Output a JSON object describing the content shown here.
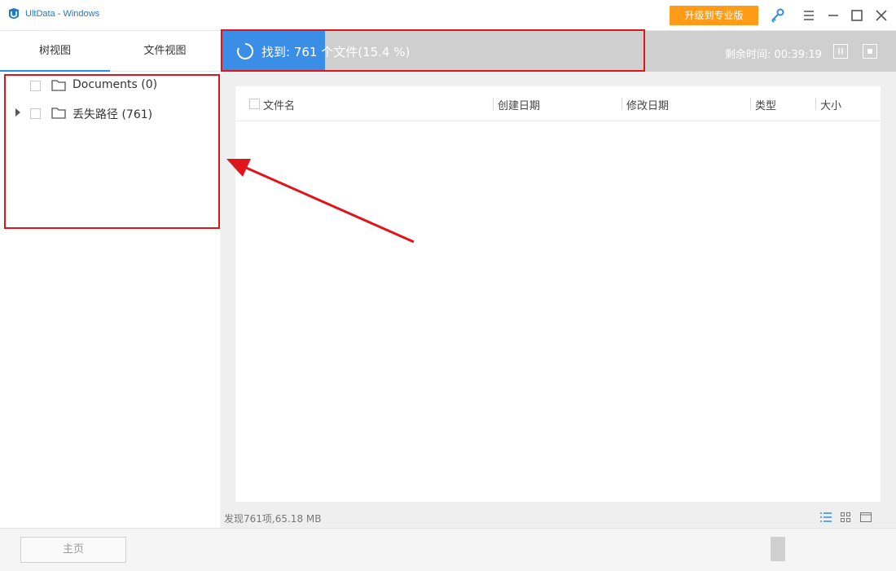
{
  "window": {
    "title": "UltData - Windows",
    "upgrade_label": "升级到专业版"
  },
  "sidebar": {
    "tabs": [
      "树视图",
      "文件视图"
    ],
    "tree": [
      {
        "label": "Documents (0)",
        "expandable": false
      },
      {
        "label": "丢失路径 (761)",
        "expandable": true
      }
    ]
  },
  "scan": {
    "found_text": "找到: 761 个文件(15.4 %)",
    "progress_fraction": 0.154,
    "remaining_text": "剩余时间: 00:39:19"
  },
  "table": {
    "columns": [
      "文件名",
      "创建日期",
      "修改日期",
      "类型",
      "大小"
    ]
  },
  "status": {
    "summary": "发现761项,65.18 MB"
  },
  "footer": {
    "home_label": "主页"
  },
  "colors": {
    "accent": "#3a8ee6",
    "upgrade": "#ff9b17",
    "annotation": "#e0151b"
  },
  "icons": [
    "app-logo",
    "key-icon",
    "menu-icon",
    "minimize-icon",
    "maximize-icon",
    "close-icon",
    "spinner-icon",
    "pause-icon",
    "stop-icon",
    "folder-icon",
    "list-view-icon",
    "grid-view-icon",
    "preview-view-icon"
  ]
}
